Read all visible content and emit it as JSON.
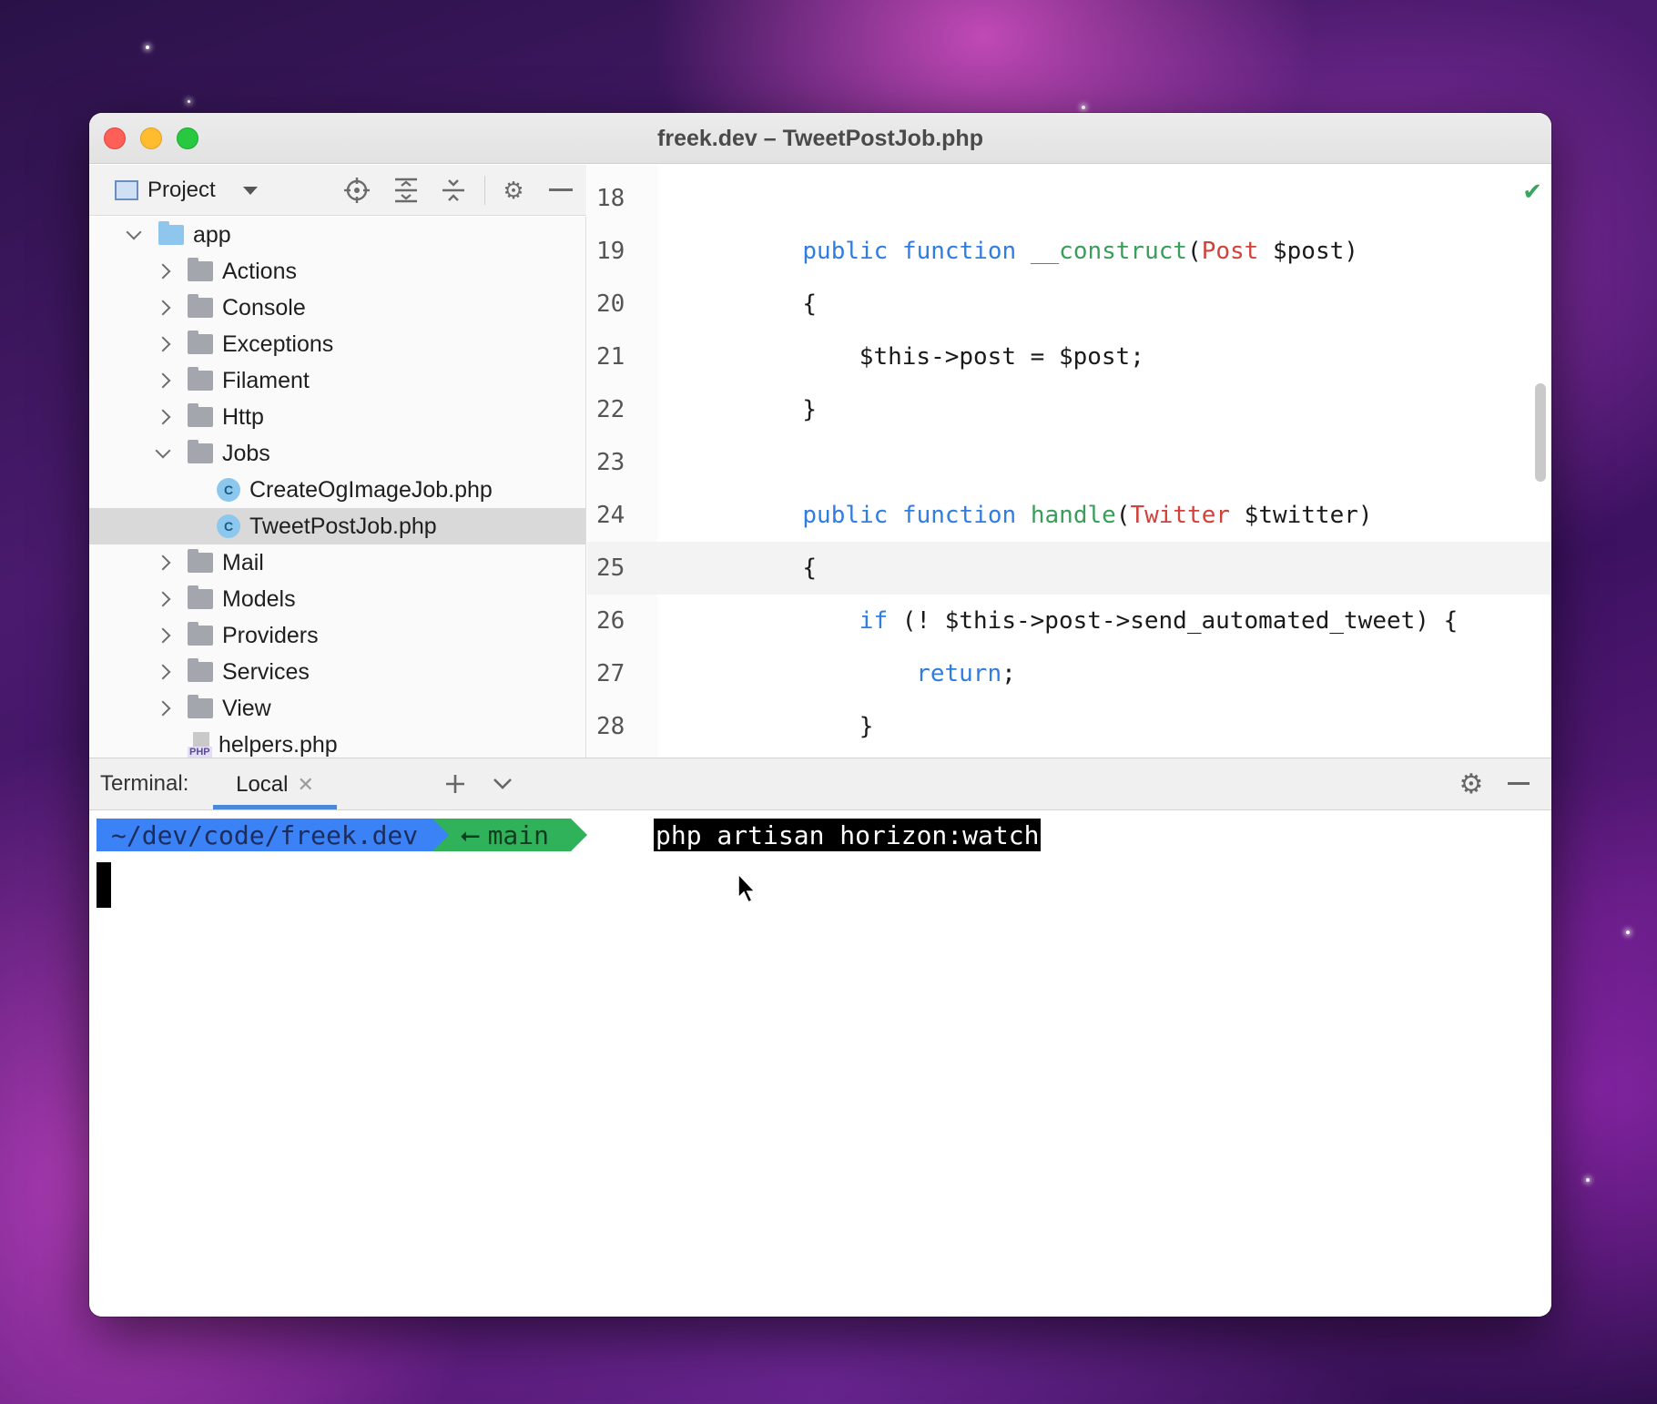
{
  "window": {
    "title": "freek.dev – TweetPostJob.php"
  },
  "project_panel": {
    "label": "Project",
    "tree": [
      {
        "label": "app",
        "kind": "folder-root",
        "state": "open",
        "depth": 0
      },
      {
        "label": "Actions",
        "kind": "folder",
        "state": "closed",
        "depth": 1
      },
      {
        "label": "Console",
        "kind": "folder",
        "state": "closed",
        "depth": 1
      },
      {
        "label": "Exceptions",
        "kind": "folder",
        "state": "closed",
        "depth": 1
      },
      {
        "label": "Filament",
        "kind": "folder",
        "state": "closed",
        "depth": 1
      },
      {
        "label": "Http",
        "kind": "folder",
        "state": "closed",
        "depth": 1
      },
      {
        "label": "Jobs",
        "kind": "folder",
        "state": "open",
        "depth": 1
      },
      {
        "label": "CreateOgImageJob.php",
        "kind": "class",
        "depth": 2
      },
      {
        "label": "TweetPostJob.php",
        "kind": "class",
        "depth": 2,
        "selected": true
      },
      {
        "label": "Mail",
        "kind": "folder",
        "state": "closed",
        "depth": 1
      },
      {
        "label": "Models",
        "kind": "folder",
        "state": "closed",
        "depth": 1
      },
      {
        "label": "Providers",
        "kind": "folder",
        "state": "closed",
        "depth": 1
      },
      {
        "label": "Services",
        "kind": "folder",
        "state": "closed",
        "depth": 1
      },
      {
        "label": "View",
        "kind": "folder",
        "state": "closed",
        "depth": 1
      },
      {
        "label": "helpers.php",
        "kind": "php",
        "depth": 1
      }
    ]
  },
  "editor": {
    "current_line": "25",
    "lines": [
      {
        "n": "18",
        "indent": 0,
        "tokens": []
      },
      {
        "n": "19",
        "indent": 4,
        "tokens": [
          {
            "t": "public",
            "c": "kw"
          },
          {
            "t": " ",
            "c": ""
          },
          {
            "t": "function",
            "c": "kw"
          },
          {
            "t": " ",
            "c": ""
          },
          {
            "t": "__construct",
            "c": "fn"
          },
          {
            "t": "(",
            "c": ""
          },
          {
            "t": "Post",
            "c": "ty"
          },
          {
            "t": " $post)",
            "c": ""
          }
        ]
      },
      {
        "n": "20",
        "indent": 4,
        "tokens": [
          {
            "t": "{",
            "c": ""
          }
        ]
      },
      {
        "n": "21",
        "indent": 8,
        "tokens": [
          {
            "t": "$this->post = $post;",
            "c": ""
          }
        ]
      },
      {
        "n": "22",
        "indent": 4,
        "tokens": [
          {
            "t": "}",
            "c": ""
          }
        ]
      },
      {
        "n": "23",
        "indent": 0,
        "tokens": []
      },
      {
        "n": "24",
        "indent": 4,
        "tokens": [
          {
            "t": "public",
            "c": "kw"
          },
          {
            "t": " ",
            "c": ""
          },
          {
            "t": "function",
            "c": "kw"
          },
          {
            "t": " ",
            "c": ""
          },
          {
            "t": "handle",
            "c": "fn"
          },
          {
            "t": "(",
            "c": ""
          },
          {
            "t": "Twitter",
            "c": "ty"
          },
          {
            "t": " $twitter)",
            "c": ""
          }
        ]
      },
      {
        "n": "25",
        "indent": 4,
        "tokens": [
          {
            "t": "{",
            "c": ""
          }
        ]
      },
      {
        "n": "26",
        "indent": 8,
        "tokens": [
          {
            "t": "if",
            "c": "kw"
          },
          {
            "t": " (! $this->post->send_automated_tweet) {",
            "c": ""
          }
        ]
      },
      {
        "n": "27",
        "indent": 12,
        "tokens": [
          {
            "t": "return",
            "c": "kw"
          },
          {
            "t": ";",
            "c": ""
          }
        ]
      },
      {
        "n": "28",
        "indent": 8,
        "tokens": [
          {
            "t": "}",
            "c": ""
          }
        ]
      }
    ]
  },
  "terminal": {
    "label": "Terminal:",
    "tab_label": "Local",
    "prompt_path": "~/dev/code/freek.dev",
    "prompt_branch": "main",
    "branch_icon": "branch-icon",
    "command": "php artisan horizon:watch"
  },
  "colors": {
    "keyword": "#2f7de1",
    "function": "#3a9d5a",
    "type": "#d2413a",
    "prompt_path_bg": "#3b82f6",
    "prompt_branch_bg": "#2fb25a"
  }
}
